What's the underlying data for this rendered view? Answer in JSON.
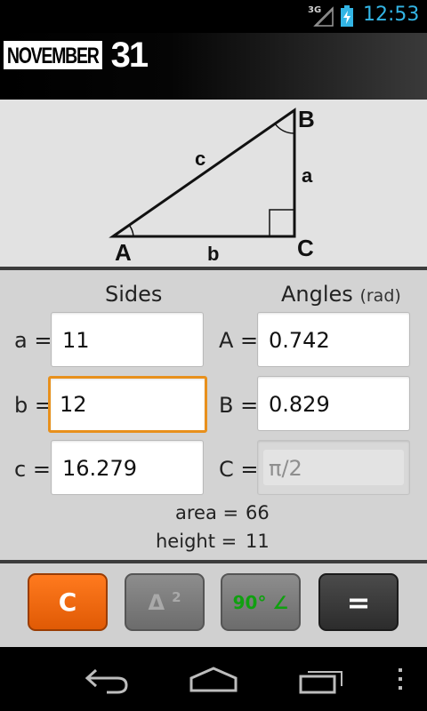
{
  "status_bar": {
    "network": "3G",
    "time": "12:53",
    "time_color": "#33b5e5"
  },
  "header": {
    "logo_word": "NOVEMBER",
    "logo_number": "31"
  },
  "triangle": {
    "vertex_a": "A",
    "vertex_b": "B",
    "vertex_c": "C",
    "side_a": "a",
    "side_b": "b",
    "side_c": "c"
  },
  "sides": {
    "heading": "Sides",
    "a_label": "a =",
    "a_value": "11",
    "b_label": "b =",
    "b_value": "12",
    "c_label": "c =",
    "c_value": "16.279"
  },
  "angles": {
    "heading": "Angles",
    "unit": "(rad)",
    "A_label": "A =",
    "A_value": "0.742",
    "B_label": "B =",
    "B_value": "0.829",
    "C_label": "C =",
    "C_value": "π/2"
  },
  "results": {
    "area_label": "area =",
    "area_value": "66",
    "height_label": "height =",
    "height_value": "11"
  },
  "buttons": {
    "clear": "C",
    "square": "Δ",
    "square_sup": "2",
    "right_angle": "90° ∠",
    "equals": "=",
    "clear_color": "#f26a0f",
    "right_angle_color": "#10a010"
  },
  "icons": {
    "signal": "signal-3g-icon",
    "battery": "battery-charging-icon",
    "back": "back-arrow-icon",
    "home": "home-icon",
    "recents": "recent-apps-icon",
    "menu": "overflow-menu-icon"
  }
}
